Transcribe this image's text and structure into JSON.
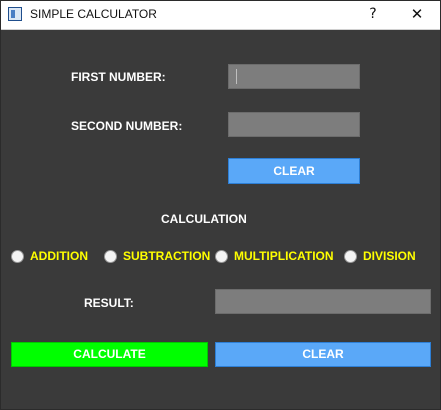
{
  "window": {
    "title": "SIMPLE CALCULATOR",
    "help_glyph": "?",
    "close_glyph": "✕"
  },
  "form": {
    "first_number_label": "FIRST NUMBER:",
    "first_number_value": "",
    "second_number_label": "SECOND NUMBER:",
    "second_number_value": "",
    "clear_inputs_label": "CLEAR",
    "calculation_label": "CALCULATION",
    "operations": [
      "ADDITION",
      "SUBTRACTION",
      "MULTIPLICATION",
      "DIVISION"
    ],
    "result_label": "RESULT:",
    "result_value": "",
    "calculate_label": "CALCULATE",
    "clear_all_label": "CLEAR"
  },
  "colors": {
    "background": "#3a3a3a",
    "field": "#7d7d7d",
    "accent_blue": "#5aa8f8",
    "accent_green": "#00ff00",
    "radio_text": "#ffff00"
  },
  "icons": {
    "app": "calculator-window-icon",
    "help": "question-mark-icon",
    "close": "close-icon"
  }
}
